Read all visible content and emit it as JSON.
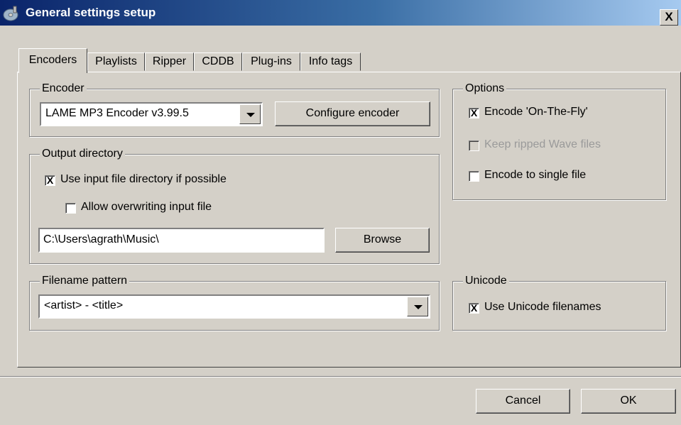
{
  "window": {
    "title": "General settings setup",
    "close_glyph": "X",
    "icon": "cd-icon"
  },
  "tabs": [
    {
      "label": "Encoders"
    },
    {
      "label": "Playlists"
    },
    {
      "label": "Ripper"
    },
    {
      "label": "CDDB"
    },
    {
      "label": "Plug-ins"
    },
    {
      "label": "Info tags"
    }
  ],
  "active_tab": "Encoders",
  "encoder": {
    "legend": "Encoder",
    "selected": "LAME MP3 Encoder v3.99.5",
    "configure_label": "Configure encoder"
  },
  "output": {
    "legend": "Output directory",
    "use_input_dir": {
      "label": "Use input file directory if possible",
      "checked_glyph": "X"
    },
    "allow_overwrite": {
      "label": "Allow overwriting input file",
      "checked_glyph": ""
    },
    "path": "C:\\Users\\agrath\\Music\\",
    "browse_label": "Browse"
  },
  "filename": {
    "legend": "Filename pattern",
    "selected": "<artist> - <title>"
  },
  "options": {
    "legend": "Options",
    "otf": {
      "label": "Encode 'On-The-Fly'",
      "checked_glyph": "X"
    },
    "keep_wave": {
      "label": "Keep ripped Wave files",
      "checked_glyph": ""
    },
    "single_file": {
      "label": "Encode to single file",
      "checked_glyph": ""
    }
  },
  "unicode": {
    "legend": "Unicode",
    "use_unicode": {
      "label": "Use Unicode filenames",
      "checked_glyph": "X"
    }
  },
  "footer": {
    "cancel_label": "Cancel",
    "ok_label": "OK"
  }
}
